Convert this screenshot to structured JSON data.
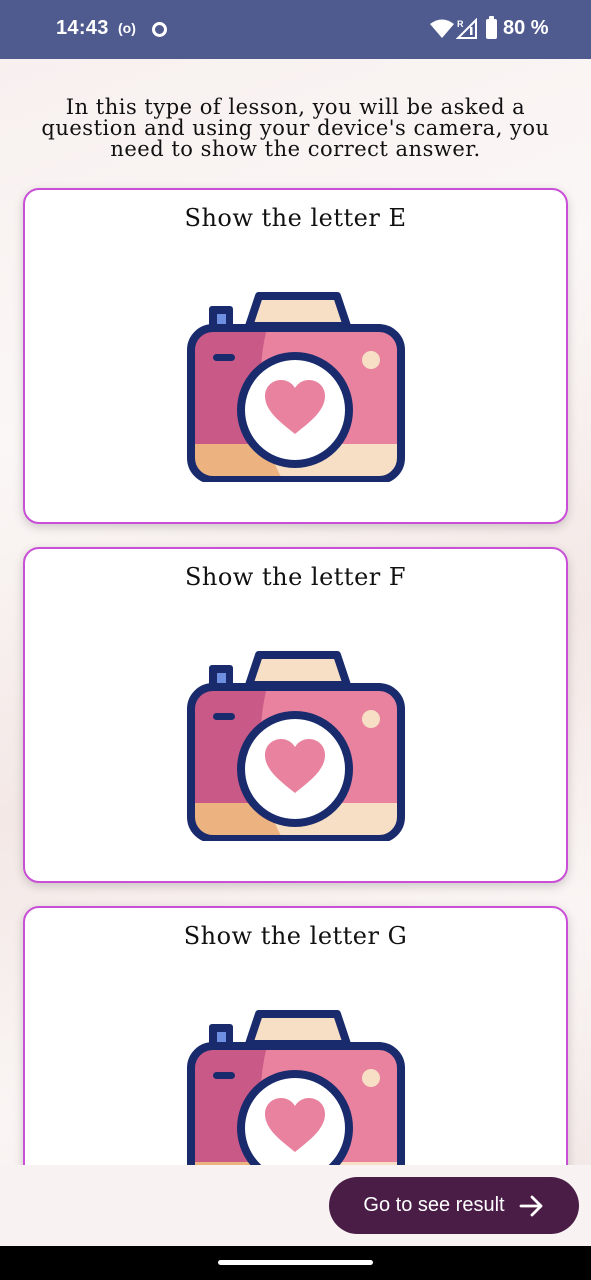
{
  "status_bar": {
    "time": "14:43",
    "radio_indicator": "(o)",
    "battery": "80 %",
    "icons": [
      "hotspot-icon",
      "record-icon",
      "wifi-icon",
      "signal-icon",
      "battery-icon"
    ]
  },
  "intro_text": "In this type of lesson, you will be asked a question and using your device's camera, you need to show the correct answer.",
  "cards": [
    {
      "title": "Show the letter E",
      "icon": "camera-heart-icon"
    },
    {
      "title": "Show the letter F",
      "icon": "camera-heart-icon"
    },
    {
      "title": "Show the letter G",
      "icon": "camera-heart-icon"
    }
  ],
  "bottom": {
    "button_label": "Go to see result",
    "button_icon": "arrow-right-icon"
  },
  "colors": {
    "status_bar": "#4f5a8f",
    "card_border": "#c94fd6",
    "button": "#4a1d47",
    "camera_outline": "#1a2b6d",
    "camera_body": "#e8829e",
    "camera_shade": "#c95a87",
    "camera_top": "#f7dfc5",
    "camera_stripe": "#ecb27f"
  }
}
